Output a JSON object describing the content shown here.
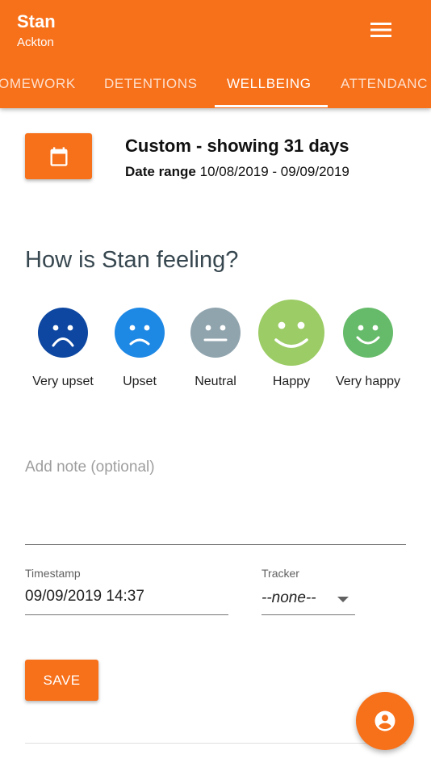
{
  "header": {
    "name": "Stan",
    "school": "Ackton",
    "menu_icon": "hamburger-menu-icon"
  },
  "tabs": [
    {
      "label": "OMEWORK"
    },
    {
      "label": "DETENTIONS"
    },
    {
      "label": "WELLBEING"
    },
    {
      "label": "ATTENDANC"
    }
  ],
  "active_tab": "WELLBEING",
  "date_range": {
    "title": "Custom - showing 31 days",
    "label": "Date range",
    "value": "10/08/2019 - 09/09/2019",
    "icon": "calendar-icon"
  },
  "wellbeing": {
    "question": "How is Stan feeling?",
    "moods": [
      {
        "label": "Very upset",
        "color": "#0d47a1"
      },
      {
        "label": "Upset",
        "color": "#1e88e5"
      },
      {
        "label": "Neutral",
        "color": "#90a4ae"
      },
      {
        "label": "Happy",
        "color": "#9ccc65"
      },
      {
        "label": "Very happy",
        "color": "#66bb6a"
      }
    ],
    "selected_mood": "Happy"
  },
  "form": {
    "note_placeholder": "Add note (optional)",
    "timestamp_label": "Timestamp",
    "timestamp_value": "09/09/2019 14:37",
    "tracker_label": "Tracker",
    "tracker_value": "--none--",
    "save_label": "SAVE"
  },
  "fab_icon": "account-circle-icon",
  "colors": {
    "primary": "#f7701a",
    "text": "#212121",
    "muted": "#9e9e9e"
  }
}
